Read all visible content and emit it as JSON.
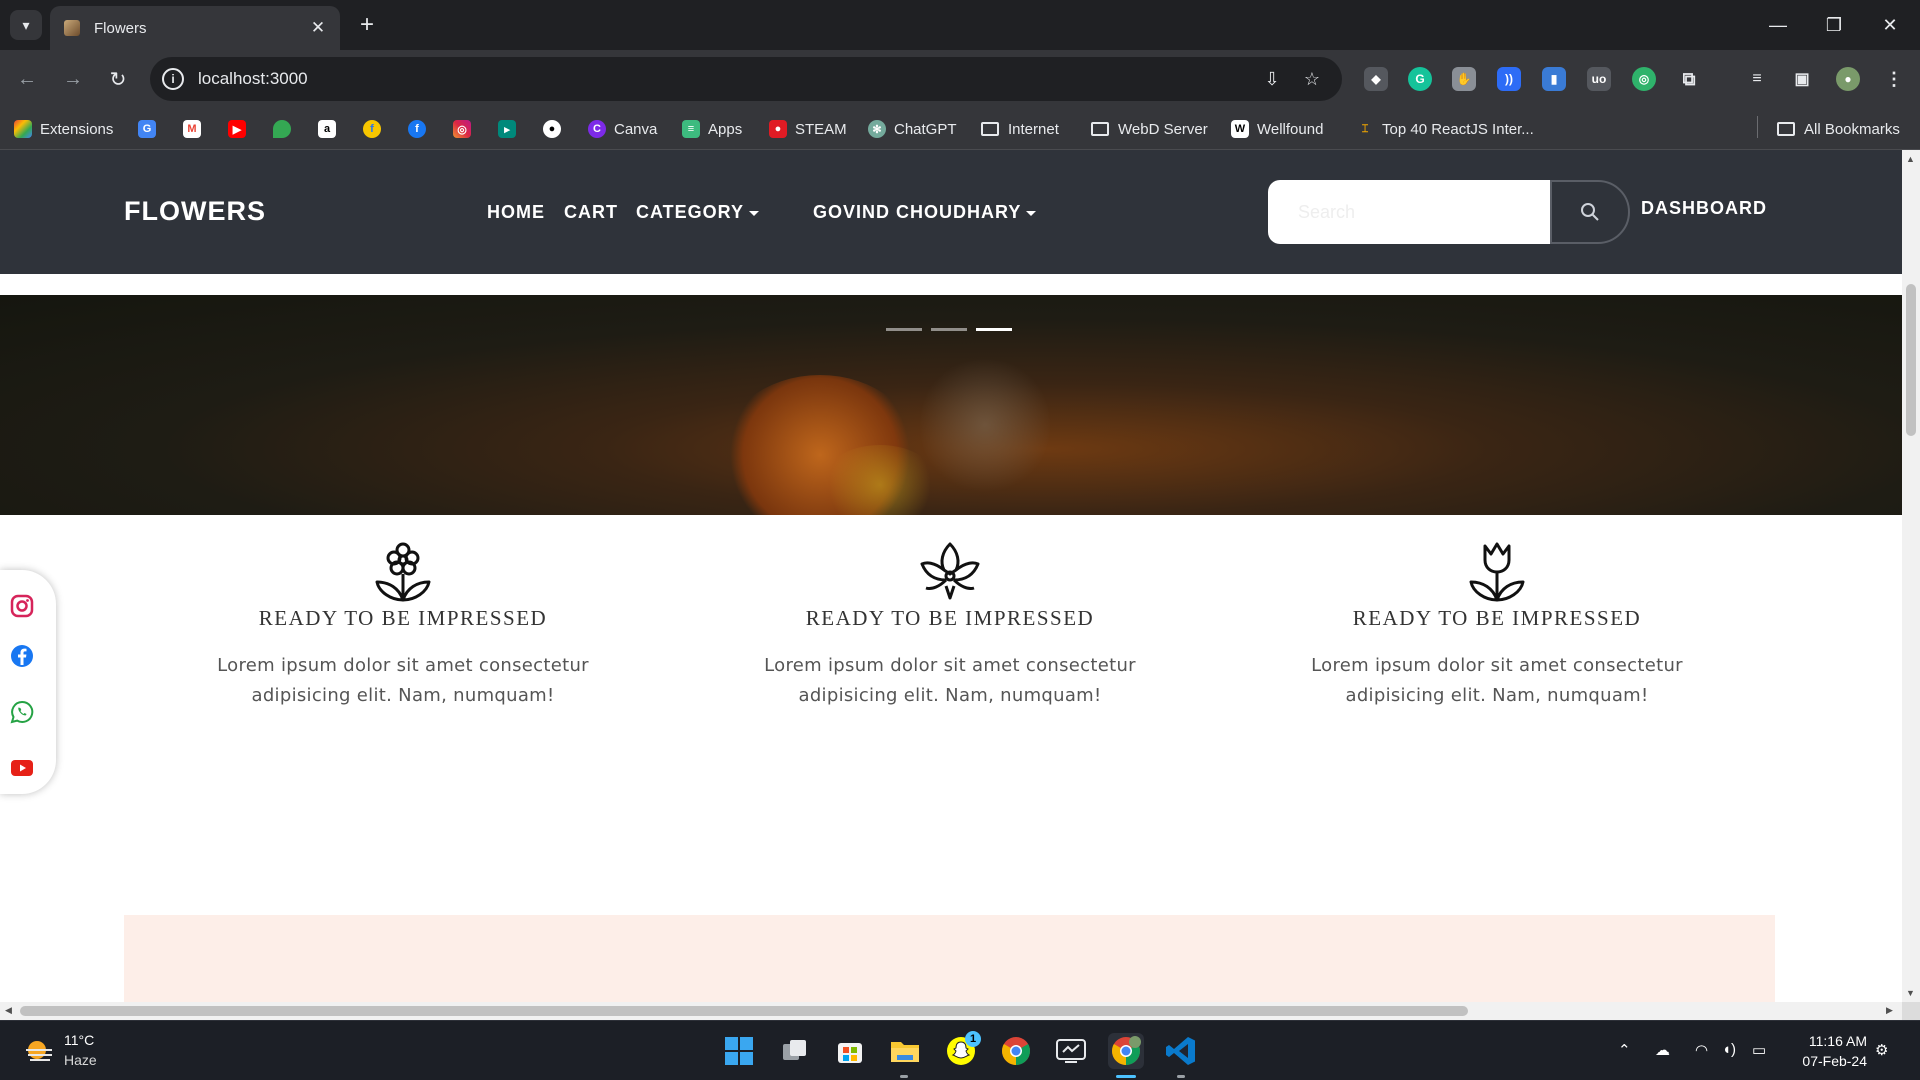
{
  "browser": {
    "tab_title": "Flowers",
    "url": "localhost:3000",
    "bookmarks": [
      {
        "label": "Extensions",
        "icon": "extensions-icon"
      },
      {
        "label": "",
        "icon": "google-translate-icon"
      },
      {
        "label": "",
        "icon": "gmail-icon"
      },
      {
        "label": "",
        "icon": "youtube-icon"
      },
      {
        "label": "",
        "icon": "maps-icon"
      },
      {
        "label": "",
        "icon": "amazon-icon"
      },
      {
        "label": "",
        "icon": "flipkart-icon"
      },
      {
        "label": "",
        "icon": "facebook-icon"
      },
      {
        "label": "",
        "icon": "instagram-icon"
      },
      {
        "label": "",
        "icon": "google-meet-icon"
      },
      {
        "label": "",
        "icon": "github-icon"
      },
      {
        "label": "Canva",
        "icon": "canva-icon"
      },
      {
        "label": "Apps",
        "icon": "apps-icon"
      },
      {
        "label": "STEAM",
        "icon": "steam-icon"
      },
      {
        "label": "ChatGPT",
        "icon": "chatgpt-icon"
      },
      {
        "label": "Internet",
        "icon": "folder-icon"
      },
      {
        "label": "WebD Server",
        "icon": "folder-icon"
      },
      {
        "label": "Wellfound",
        "icon": "wellfound-icon"
      },
      {
        "label": "Top 40 ReactJS Inter...",
        "icon": "article-icon"
      },
      {
        "label": "All Bookmarks",
        "icon": "folder-icon"
      }
    ]
  },
  "site": {
    "brand": "FLOWERS",
    "nav": {
      "home": "HOME",
      "cart": "CART",
      "category": "CATEGORY",
      "user": "GOVIND CHOUDHARY",
      "dashboard": "DASHBOARD"
    },
    "search": {
      "placeholder": "Search",
      "value": ""
    },
    "carousel": {
      "slide_count": 3,
      "active_index": 2
    },
    "features": [
      {
        "icon": "flower-icon",
        "title": "READY TO BE IMPRESSED",
        "text": "Lorem ipsum dolor sit amet consectetur adipisicing elit. Nam, numquam!"
      },
      {
        "icon": "lotus-icon",
        "title": "READY TO BE IMPRESSED",
        "text": "Lorem ipsum dolor sit amet consectetur adipisicing elit. Nam, numquam!"
      },
      {
        "icon": "tulip-icon",
        "title": "READY TO BE IMPRESSED",
        "text": "Lorem ipsum dolor sit amet consectetur adipisicing elit. Nam, numquam!"
      }
    ],
    "social": [
      "instagram-icon",
      "facebook-icon",
      "whatsapp-icon",
      "youtube-icon"
    ],
    "colors": {
      "navbar": "#2f333a",
      "accent_section": "#fdeee8",
      "text": "#555555"
    }
  },
  "taskbar": {
    "weather": {
      "temp": "11°C",
      "condition": "Haze"
    },
    "clock": {
      "time": "11:16 AM",
      "date": "07-Feb-24"
    },
    "notification_badge": "1",
    "apps": [
      "start-icon",
      "task-view-icon",
      "microsoft-store-icon",
      "file-explorer-icon",
      "snapchat-icon",
      "chrome-icon",
      "remote-desktop-icon",
      "chrome-profile-icon",
      "vscode-icon"
    ]
  }
}
